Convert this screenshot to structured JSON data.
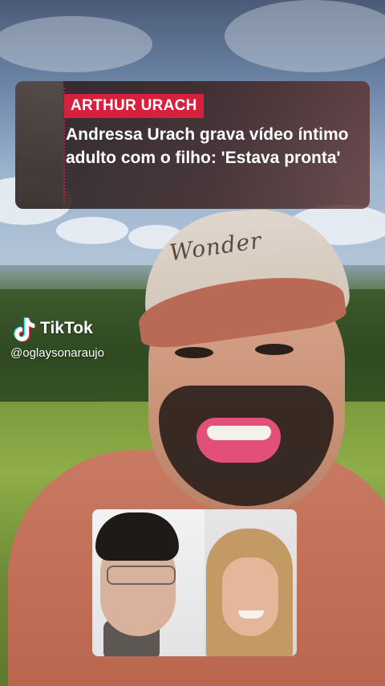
{
  "news_card": {
    "tag": "ARTHUR URACH",
    "headline": "Andressa Urach grava vídeo íntimo adulto com o filho: 'Estava pronta'",
    "tag_color": "#d6203c"
  },
  "watermark": {
    "app_name": "TikTok",
    "handle": "@oglaysonaraujo",
    "icon": "tiktok-logo-icon"
  },
  "cap": {
    "logo_text": "Wonder"
  }
}
